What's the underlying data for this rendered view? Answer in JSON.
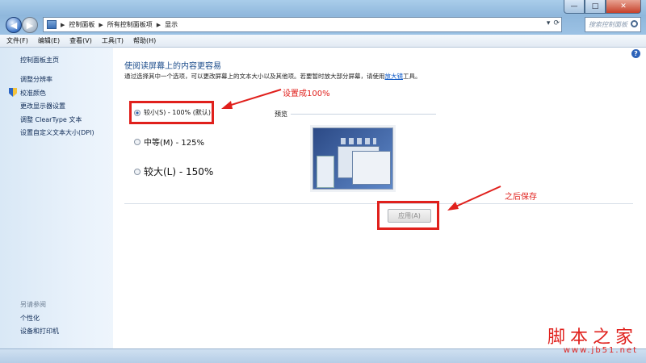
{
  "address": {
    "crumbs": [
      "控制面板",
      "所有控制面板项",
      "显示"
    ],
    "search_placeholder": "搜索控制面板"
  },
  "window_controls": {
    "minimize": "—",
    "maximize": "□",
    "close": "✕"
  },
  "menu": [
    "文件(F)",
    "编辑(E)",
    "查看(V)",
    "工具(T)",
    "帮助(H)"
  ],
  "sidebar": {
    "home": "控制面板主页",
    "links": [
      "调整分辨率",
      "校准颜色",
      "更改显示器设置",
      "调整 ClearType 文本",
      "设置自定义文本大小(DPI)"
    ],
    "see_also_title": "另请参阅",
    "see_also": [
      "个性化",
      "设备和打印机"
    ]
  },
  "main": {
    "heading": "使阅读屏幕上的内容更容易",
    "description_pre": "通过选择其中一个选项，可以更改屏幕上的文本大小以及其他项。若要暂时放大部分屏幕，请使用",
    "description_link": "放大镜",
    "description_post": "工具。",
    "options": [
      {
        "label": "较小(S) - 100% (默认)",
        "checked": true
      },
      {
        "label": "中等(M) - 125%",
        "checked": false
      },
      {
        "label": "较大(L) - 150%",
        "checked": false
      }
    ],
    "preview_label": "预览",
    "apply_label": "应用(A)"
  },
  "annotations": {
    "set_100": "设置成100%",
    "save_after": "之后保存"
  },
  "watermark": {
    "text": "脚本之家",
    "url": "www.jb51.net"
  },
  "colors": {
    "annotation_red": "#e0201c",
    "link_blue": "#0b57c5",
    "heading_blue": "#1e4e8c"
  }
}
